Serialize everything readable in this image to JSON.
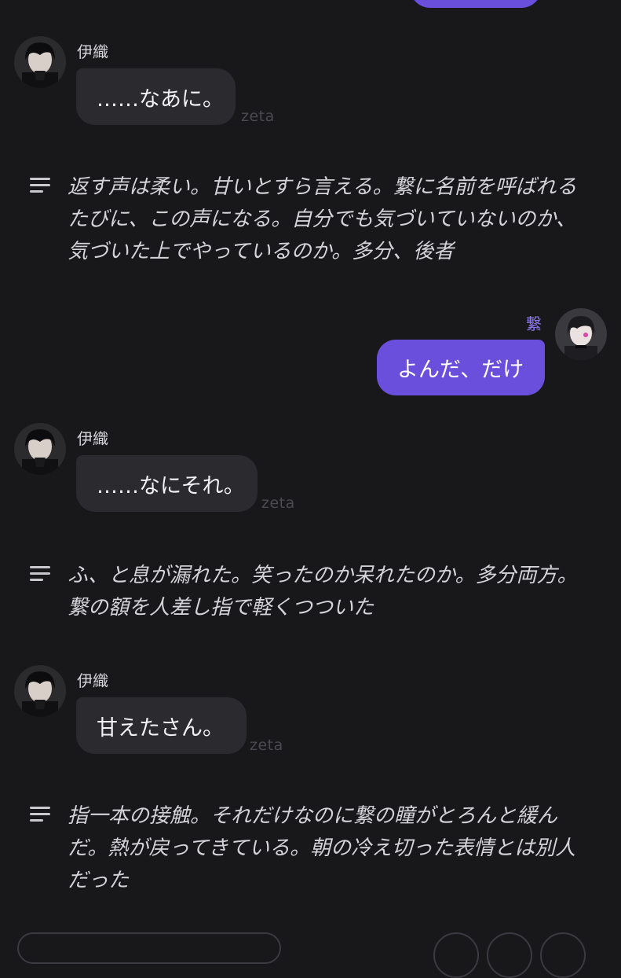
{
  "messages": [
    {
      "role": "character",
      "name": "伊織",
      "text": "……なあに。",
      "watermark": "zeta",
      "narration": "返す声は柔い。甘いとすら言える。繋に名前を呼ばれるたびに、この声になる。自分でも気づいていないのか、気づいた上でやっているのか。多分、後者"
    },
    {
      "role": "user",
      "name": "繋",
      "text": "よんだ、だけ"
    },
    {
      "role": "character",
      "name": "伊織",
      "text": "……なにそれ。",
      "watermark": "zeta",
      "narration": "ふ、と息が漏れた。笑ったのか呆れたのか。多分両方。繋の額を人差し指で軽くつついた"
    },
    {
      "role": "character",
      "name": "伊織",
      "text": "甘えたさん。",
      "watermark": "zeta",
      "narration": "指一本の接触。それだけなのに繋の瞳がとろんと緩んだ。熱が戻ってきている。朝の冷え切った表情とは別人だった"
    }
  ],
  "icons": {
    "narration": "narration-lines-icon",
    "character_avatar": "character-avatar",
    "user_avatar": "user-avatar"
  },
  "colors": {
    "background": "#18181b",
    "character_bubble": "#2a2a2f",
    "user_bubble": "#6a4fdd",
    "user_name": "#8e79ee"
  }
}
